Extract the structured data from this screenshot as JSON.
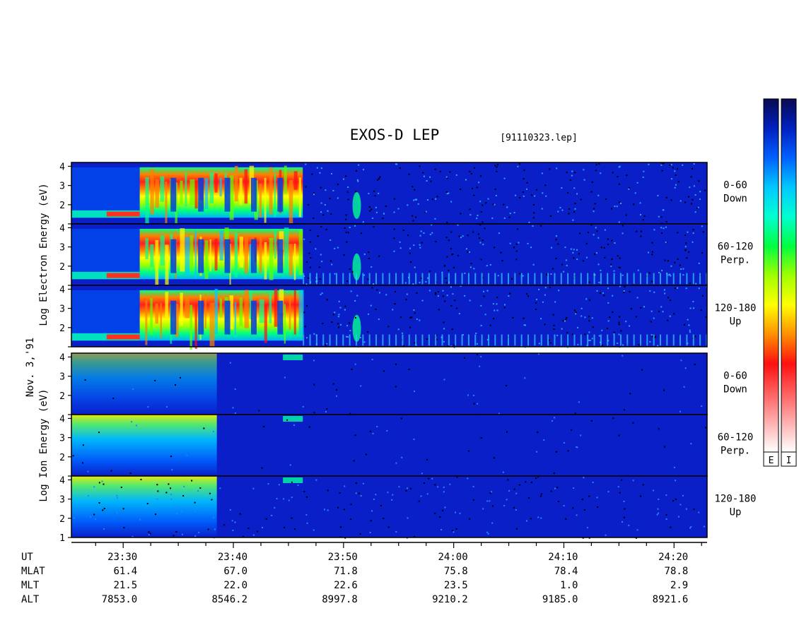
{
  "chart_data": {
    "type": "heatmap",
    "title": "EXOS-D LEP",
    "subtitle": "[91110323.lep]",
    "date_label": "Nov. 3,'91",
    "x_axis": {
      "row_labels": [
        "UT",
        "MLAT",
        "MLT",
        "ALT"
      ],
      "columns": [
        {
          "UT": "23:30",
          "MLAT": "61.4",
          "MLT": "21.5",
          "ALT": "7853.0"
        },
        {
          "UT": "23:40",
          "MLAT": "67.0",
          "MLT": "22.0",
          "ALT": "8546.2"
        },
        {
          "UT": "23:50",
          "MLAT": "71.8",
          "MLT": "22.6",
          "ALT": "8997.8"
        },
        {
          "UT": "24:00",
          "MLAT": "75.8",
          "MLT": "23.5",
          "ALT": "9210.2"
        },
        {
          "UT": "24:10",
          "MLAT": "78.4",
          "MLT": "1.0",
          "ALT": "9185.0"
        },
        {
          "UT": "24:20",
          "MLAT": "78.8",
          "MLT": "2.9",
          "ALT": "8921.6"
        }
      ],
      "range_minutes": [
        -4.7,
        53.0
      ],
      "labeled_minutes": [
        0,
        10,
        20,
        30,
        40,
        50
      ],
      "minor_tick_minutes": 2.5
    },
    "groups": [
      {
        "species": "Electron",
        "ylabel": [
          "Log",
          "Electron",
          "Energy",
          "(eV)"
        ],
        "panels": [
          {
            "pitch": "0-60",
            "direction": "Down",
            "yticks": [
              "4",
              "3",
              "2",
              ""
            ]
          },
          {
            "pitch": "60-120",
            "direction": "Perp.",
            "yticks": [
              "4",
              "3",
              "2",
              ""
            ]
          },
          {
            "pitch": "120-180",
            "direction": "Up",
            "yticks": [
              "4",
              "3",
              "2",
              ""
            ]
          }
        ],
        "ylim": [
          1,
          4.2
        ]
      },
      {
        "species": "Ion",
        "ylabel": [
          "Log",
          "Ion",
          "Energy",
          "(eV)"
        ],
        "panels": [
          {
            "pitch": "0-60",
            "direction": "Down",
            "yticks": [
              "4",
              "3",
              "2",
              ""
            ]
          },
          {
            "pitch": "60-120",
            "direction": "Perp.",
            "yticks": [
              "4",
              "3",
              "2",
              ""
            ]
          },
          {
            "pitch": "120-180",
            "direction": "Up",
            "yticks": [
              "4",
              "3",
              "2",
              "1"
            ]
          }
        ],
        "ylim": [
          1,
          4.2
        ]
      }
    ],
    "colorbars": [
      {
        "label": "E",
        "gradient": [
          "#0a0a50",
          "#0020c0",
          "#0060ff",
          "#00c8ff",
          "#00ffd0",
          "#00ff40",
          "#a0ff00",
          "#ffff00",
          "#ff9000",
          "#ff1010",
          "#ff6060",
          "#ffb0b0",
          "#ffffff"
        ]
      },
      {
        "label": "I",
        "gradient": [
          "#0a0a50",
          "#0020c0",
          "#0060ff",
          "#00c8ff",
          "#00ffd0",
          "#00ff40",
          "#a0ff00",
          "#ffff00",
          "#ff9000",
          "#ff1010",
          "#ff6060",
          "#ffb0b0",
          "#ffffff"
        ]
      }
    ],
    "background_color": "#0a1fc8",
    "intensity_palette": [
      "#0a1fc8",
      "#0060ff",
      "#00c8ff",
      "#00ff90",
      "#60ff00",
      "#ffff00",
      "#ff8000",
      "#ff1010"
    ]
  }
}
